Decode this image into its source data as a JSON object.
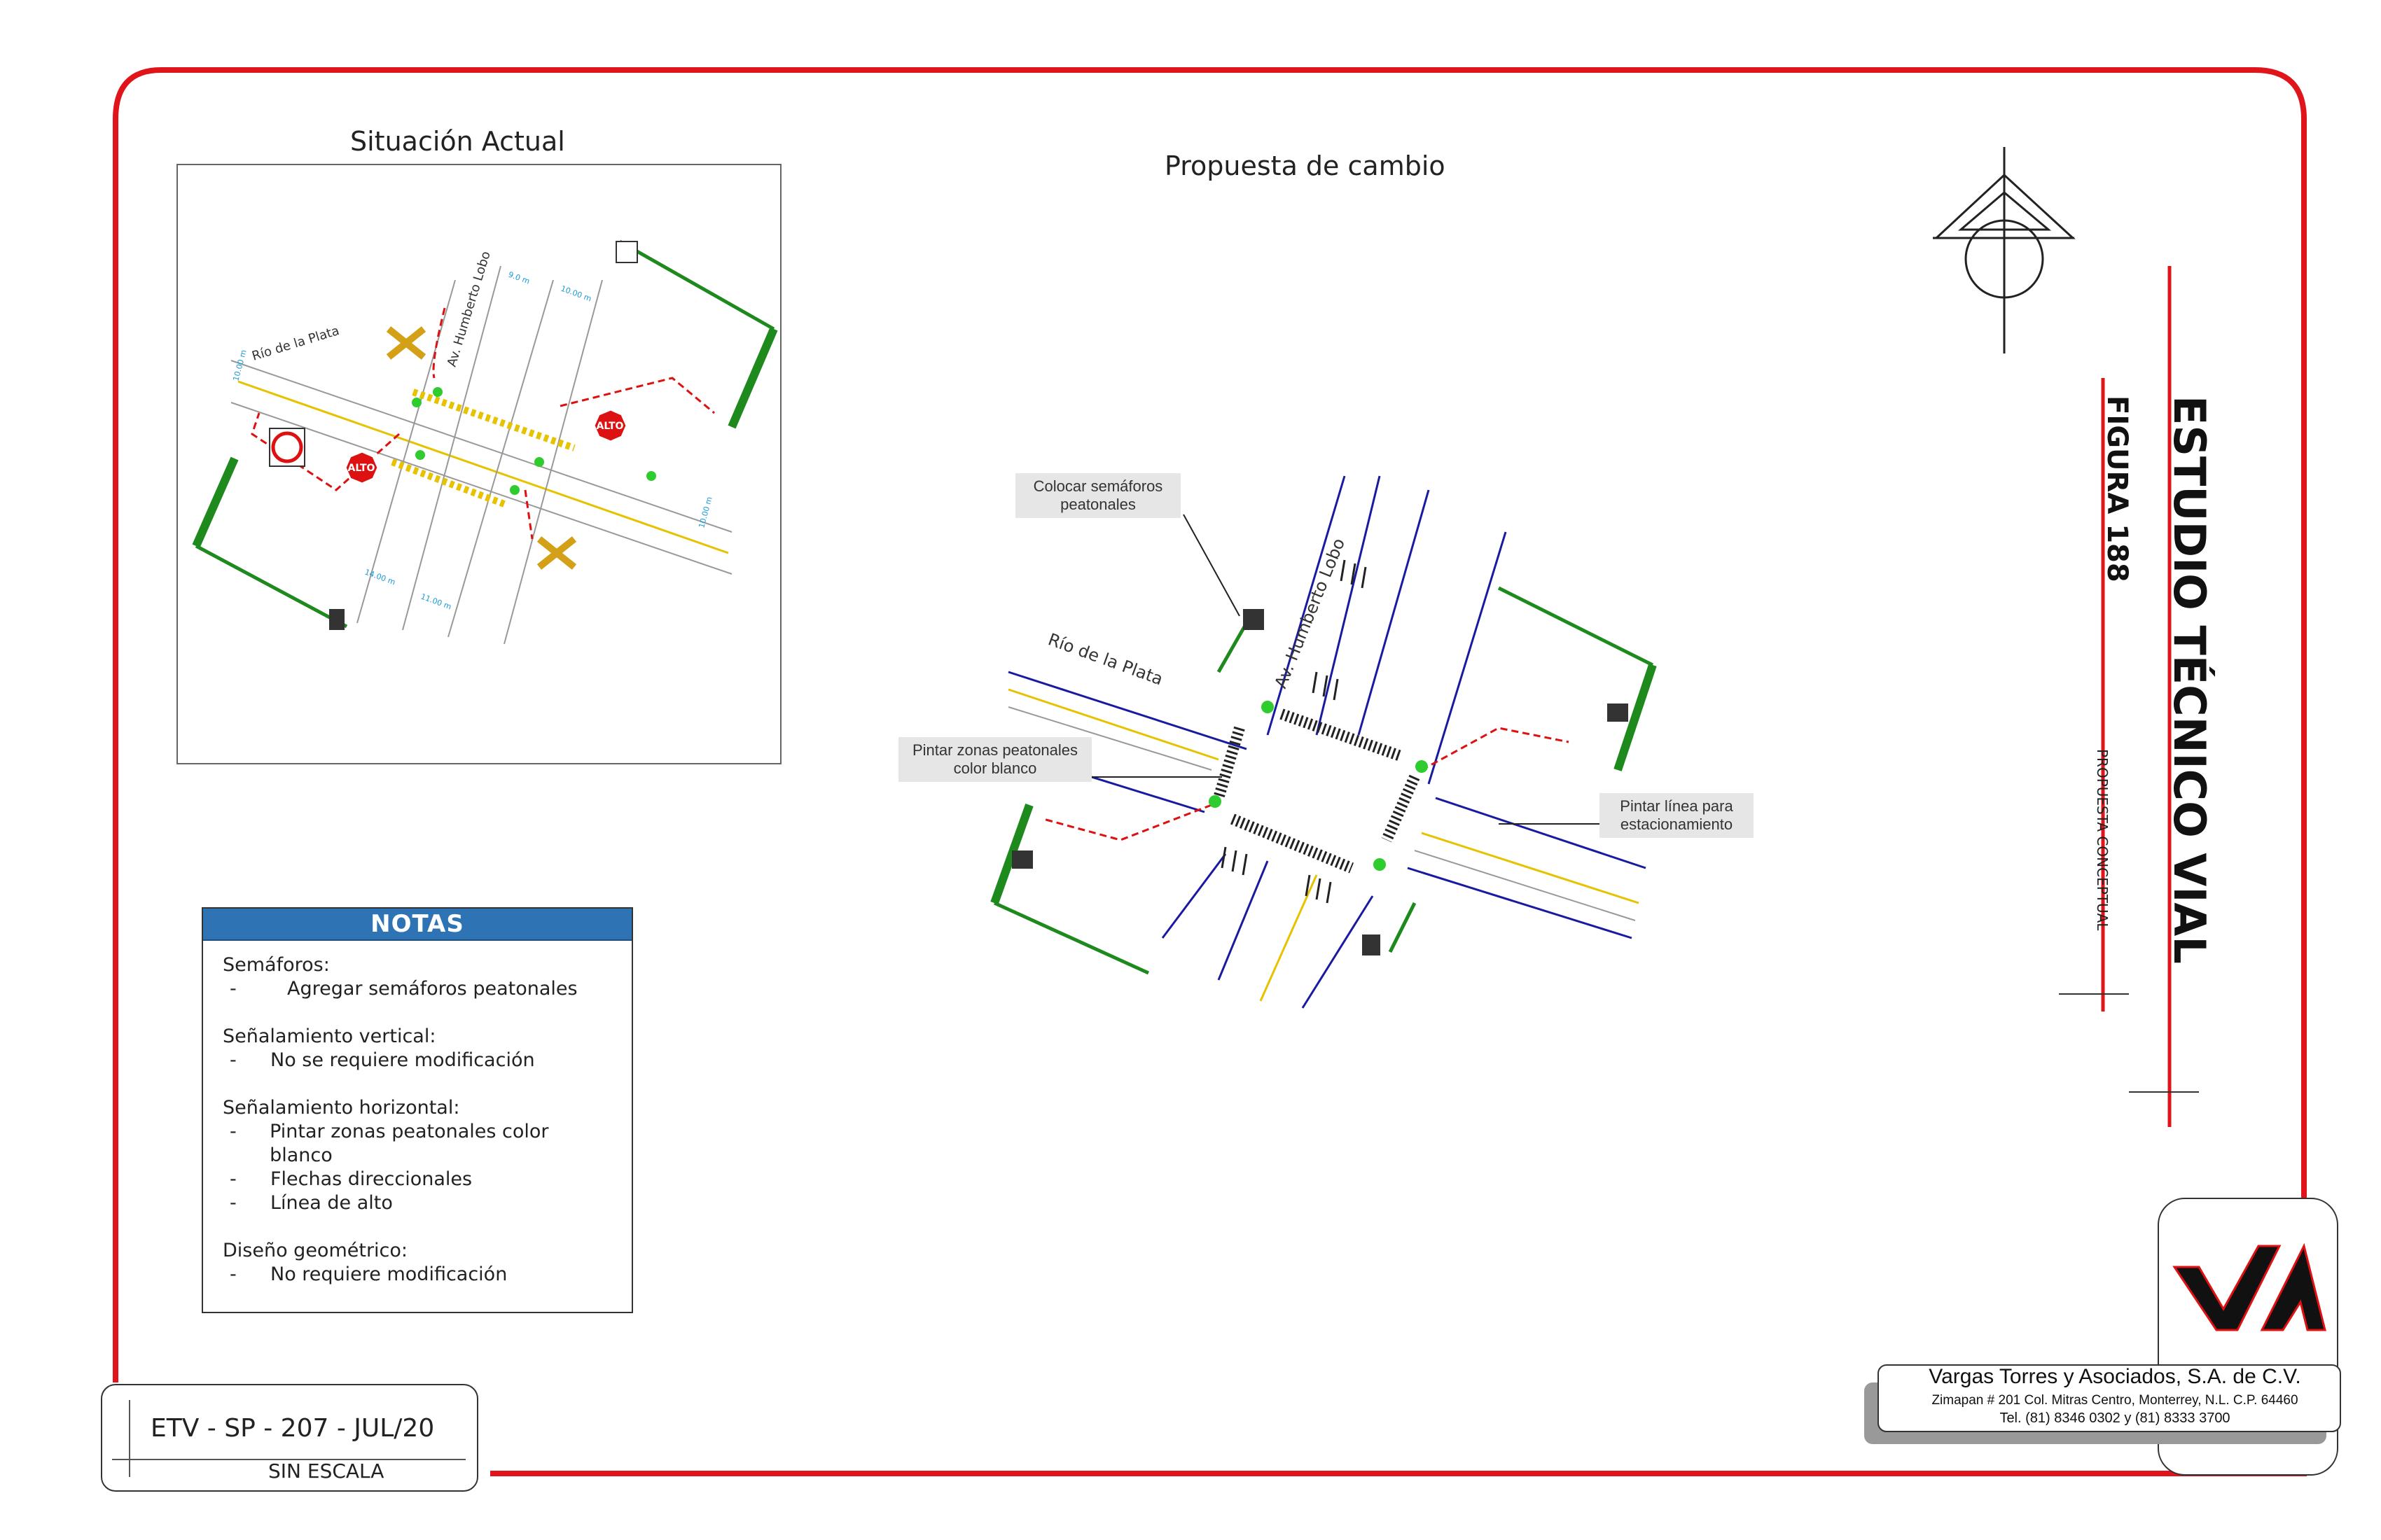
{
  "current": {
    "title": "Situación Actual"
  },
  "proposal": {
    "title": "Propuesta de cambio"
  },
  "streets": {
    "main": "Av. Humberto Lobo",
    "cross": "Río de la Plata"
  },
  "small_labels": {
    "d1": "9.0 m",
    "d2": "10.00 m",
    "d3": "10.00 m",
    "d4": "10.00 m",
    "d5": "14.00 m",
    "d6": "11.00 m"
  },
  "signs": {
    "stop": "ALTO"
  },
  "callouts": {
    "c1": "Colocar semáforos peatonales",
    "c2": "Pintar zonas peatonales color blanco",
    "c3": "Pintar línea para estacionamiento"
  },
  "notes": {
    "heading": "NOTAS",
    "sections": [
      {
        "title": "Semáforos:",
        "items": [
          "Agregar semáforos peatonales"
        ]
      },
      {
        "title": "Señalamiento vertical:",
        "items": [
          "No se requiere modificación"
        ]
      },
      {
        "title": "Señalamiento horizontal:",
        "items": [
          "Pintar zonas peatonales color blanco",
          "Flechas direccionales",
          "Línea de alto"
        ]
      },
      {
        "title": "Diseño geométrico:",
        "items": [
          "No requiere modificación"
        ]
      }
    ]
  },
  "side": {
    "main_title": "ESTUDIO TÉCNICO VIAL",
    "figure": "FIGURA 188",
    "sub": "PROPUESTA CONCEPTUAL"
  },
  "code_box": {
    "code": "ETV - SP - 207 - JUL/20",
    "scale": "SIN ESCALA"
  },
  "company": {
    "name": "Vargas Torres y Asociados, S.A. de C.V.",
    "address": "Zimapan # 201 Col. Mitras Centro, Monterrey, N.L. C.P. 64460",
    "phone": "Tel. (81) 8346 0302  y  (81) 8333 3700",
    "logo_text": "VTA"
  },
  "colors": {
    "frame": "#e0141b",
    "notes_header": "#2e74b5",
    "road_line": "#1a1aa0",
    "pole": "#1e8a1e"
  }
}
